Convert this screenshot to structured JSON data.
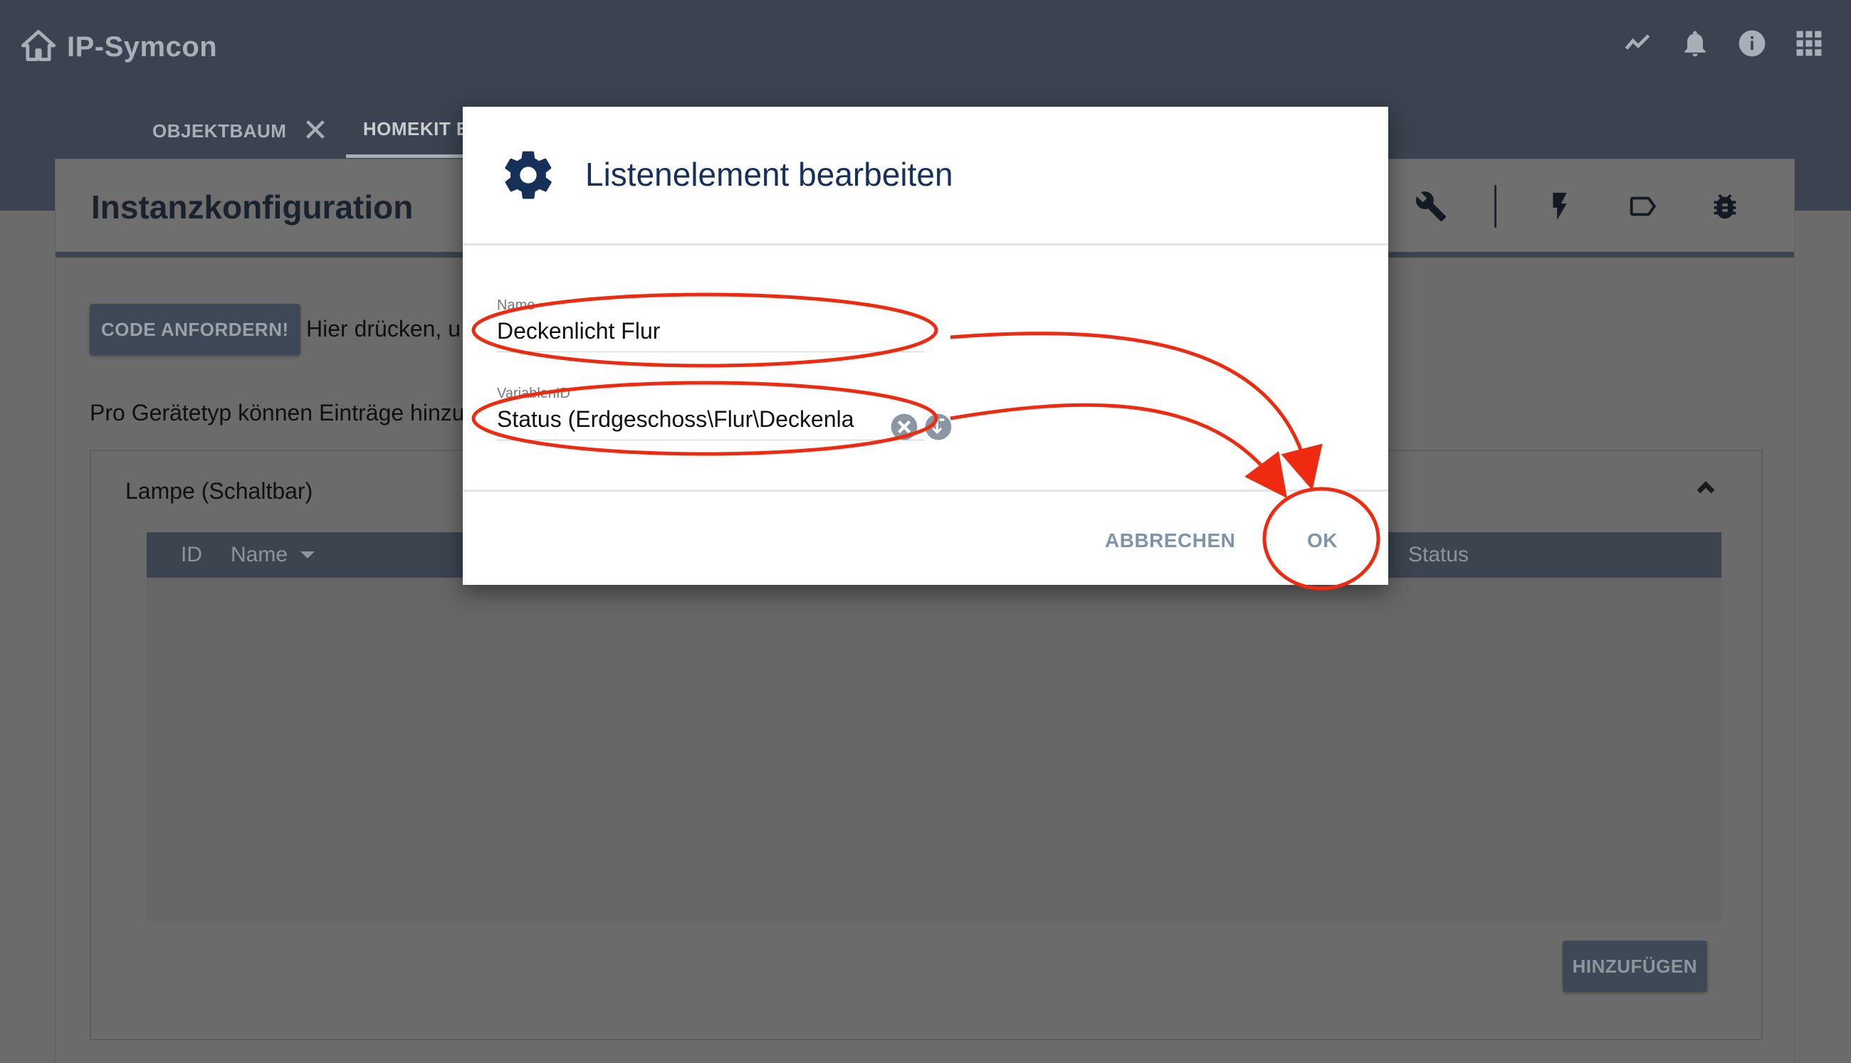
{
  "app": {
    "title": "IP-Symcon"
  },
  "tabs": [
    {
      "label": "OBJEKTBAUM",
      "close": "✕"
    },
    {
      "label": "HOMEKIT B"
    }
  ],
  "page": {
    "title": "Instanzkonfiguration",
    "code_button": "CODE ANFORDERN!",
    "code_hint": "Hier drücken, u",
    "pro_text": "Pro Gerätetyp können Einträge hinzu"
  },
  "panel": {
    "title": "Lampe (Schaltbar)",
    "columns": [
      "ID",
      "Name",
      "Status"
    ],
    "rows": [],
    "add_button": "HINZUFÜGEN"
  },
  "dialog": {
    "title": "Listenelement bearbeiten",
    "name_label": "Name",
    "name_value": "Deckenlicht Flur",
    "variable_label": "VariablenID",
    "variable_value": "Status (Erdgeschoss\\Flur\\Deckenla",
    "cancel_label": "ABBRECHEN",
    "ok_label": "OK"
  },
  "colors": {
    "topbar": "#3b4350",
    "overlay": "#6b6b6b",
    "accent": "#16305a",
    "annotation": "#ee2a10"
  }
}
